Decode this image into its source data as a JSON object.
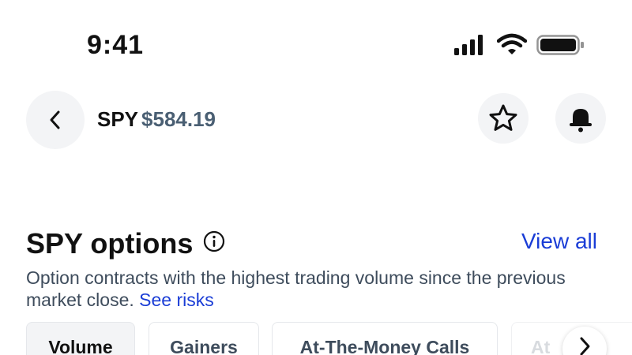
{
  "status_bar": {
    "time": "9:41",
    "icons": [
      "cellular-signal-icon",
      "wifi-icon",
      "battery-icon"
    ]
  },
  "header": {
    "back_icon": "chevron-left-icon",
    "ticker": "SPY",
    "price": "$584.19",
    "price_color": "#4a5f73",
    "watchlist_icon": "star-icon",
    "alerts_icon": "bell-icon"
  },
  "options_section": {
    "title": "SPY options",
    "info_icon": "info-icon",
    "view_all_label": "View all",
    "link_color": "#1a3dd6",
    "description": "Option contracts with the highest trading volume since the previous market close.",
    "see_risks_label": "See risks"
  },
  "filter_chips": [
    {
      "label": "Volume",
      "selected": true
    },
    {
      "label": "Gainers",
      "selected": false
    },
    {
      "label": "At-The-Money Calls",
      "selected": false
    },
    {
      "label": "At",
      "selected": false
    }
  ],
  "scroll_next_icon": "chevron-right-icon"
}
